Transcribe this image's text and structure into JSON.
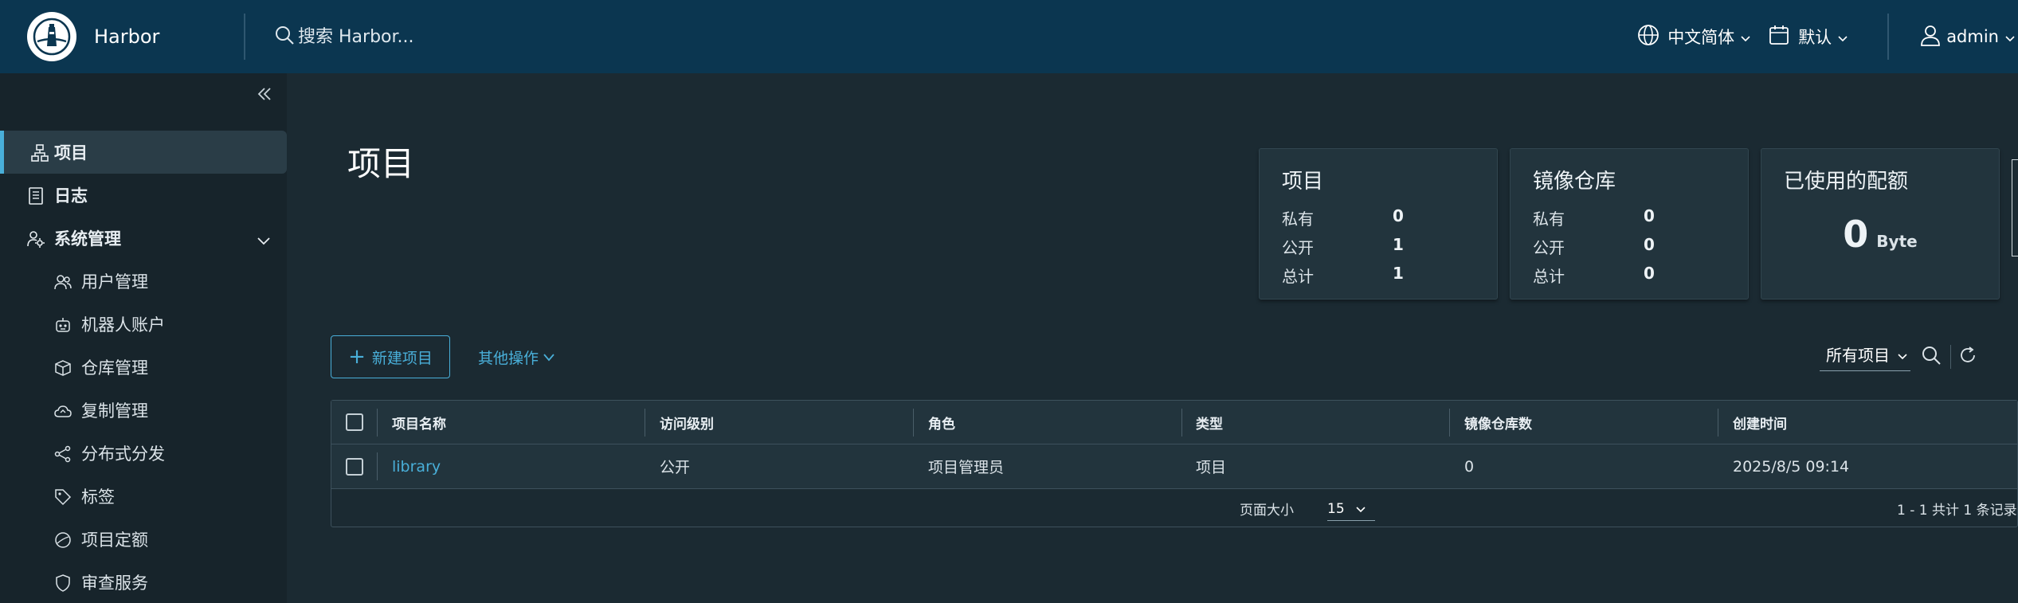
{
  "header": {
    "brand": "Harbor",
    "search_placeholder": "搜索 Harbor...",
    "language": "中文简体",
    "theme": "默认",
    "user": "admin"
  },
  "sidebar": {
    "items": [
      {
        "label": "项目",
        "icon": "projects-icon",
        "active": true
      },
      {
        "label": "日志",
        "icon": "logs-icon"
      },
      {
        "label": "系统管理",
        "icon": "admin-icon",
        "expanded": true
      }
    ],
    "sub_items": [
      {
        "label": "用户管理",
        "icon": "users-icon"
      },
      {
        "label": "机器人账户",
        "icon": "robot-icon"
      },
      {
        "label": "仓库管理",
        "icon": "registry-icon"
      },
      {
        "label": "复制管理",
        "icon": "replication-icon"
      },
      {
        "label": "分布式分发",
        "icon": "distribution-icon"
      },
      {
        "label": "标签",
        "icon": "tag-icon"
      },
      {
        "label": "项目定额",
        "icon": "quota-icon"
      },
      {
        "label": "审查服务",
        "icon": "shield-icon"
      }
    ]
  },
  "main": {
    "title": "项目",
    "cards": {
      "projects": {
        "title": "项目",
        "rows": [
          {
            "label": "私有",
            "value": "0"
          },
          {
            "label": "公开",
            "value": "1"
          },
          {
            "label": "总计",
            "value": "1"
          }
        ]
      },
      "repositories": {
        "title": "镜像仓库",
        "rows": [
          {
            "label": "私有",
            "value": "0"
          },
          {
            "label": "公开",
            "value": "0"
          },
          {
            "label": "总计",
            "value": "0"
          }
        ]
      },
      "quota": {
        "title": "已使用的配额",
        "value": "0",
        "unit": "Byte"
      }
    },
    "actions": {
      "new_project": "新建项目",
      "other_actions": "其他操作"
    },
    "filter": {
      "selected": "所有项目"
    },
    "table": {
      "columns": [
        "项目名称",
        "访问级别",
        "角色",
        "类型",
        "镜像仓库数",
        "创建时间"
      ],
      "rows": [
        [
          "library",
          "公开",
          "项目管理员",
          "项目",
          "0",
          "2025/8/5 09:14"
        ]
      ],
      "footer": {
        "page_size_label": "页面大小",
        "page_size": "15",
        "summary": "1 - 1 共计 1 条记录"
      }
    }
  },
  "colors": {
    "header_bg": "#0b3650",
    "sidebar_bg": "#17242b",
    "main_bg": "#1b2a32",
    "accent": "#49afd9",
    "card_bg": "#22343d"
  }
}
